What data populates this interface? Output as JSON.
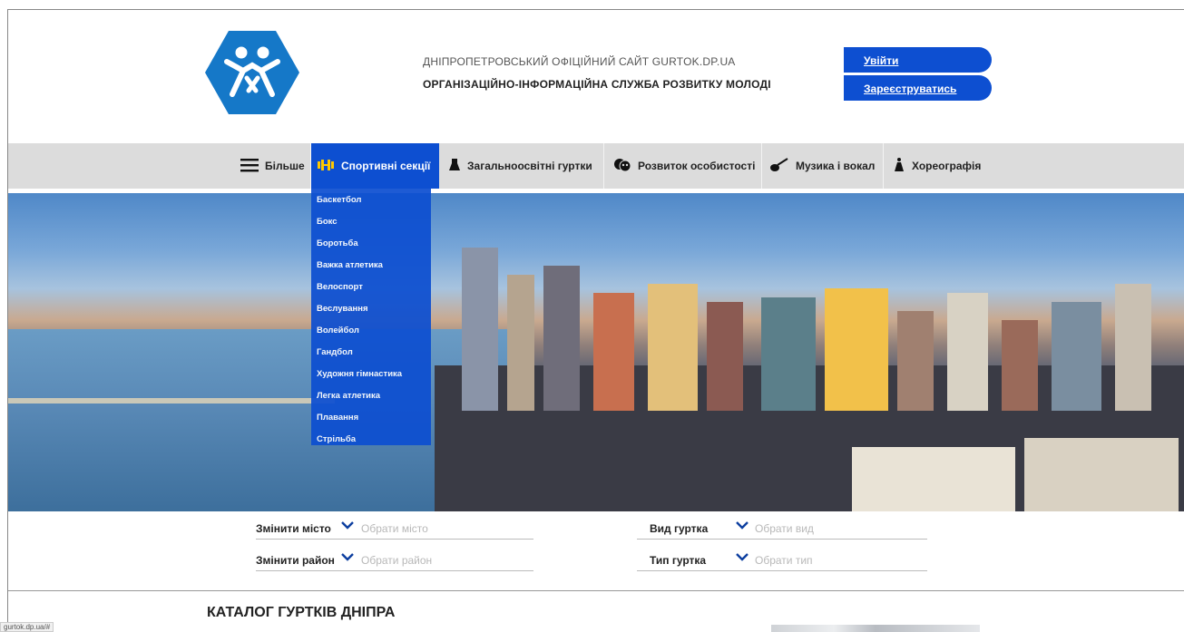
{
  "header": {
    "site_line1": "ДНІПРОПЕТРОВСЬКИЙ ОФІЦІЙНИЙ САЙТ GURTOK.DP.UA",
    "site_line2": "ОРГАНІЗАЦІЙНО-ІНФОРМАЦІЙНА СЛУЖБА РОЗВИТКУ МОЛОДІ",
    "login_label": "Увійти",
    "register_label": "Зареєструватись"
  },
  "nav": {
    "items": [
      {
        "label": "Більше",
        "icon": "hamburger-icon"
      },
      {
        "label": "Спортивні секції",
        "icon": "dumbbell-icon",
        "active": true
      },
      {
        "label": "Загальноосвітні гуртки",
        "icon": "flask-icon"
      },
      {
        "label": "Розвиток особистості",
        "icon": "masks-icon"
      },
      {
        "label": "Музика і вокал",
        "icon": "guitar-icon"
      },
      {
        "label": "Хореографія",
        "icon": "dancer-icon"
      }
    ]
  },
  "dropdown": {
    "items": [
      "Баскетбол",
      "Бокс",
      "Боротьба",
      "Важка атлетика",
      "Велоспорт",
      "Веслування",
      "Волейбол",
      "Гандбол",
      "Художня гімнастика",
      "Легка атлетика",
      "Плавання",
      "Стрільба"
    ]
  },
  "filters": {
    "city_label": "Змінити місто",
    "city_placeholder": "Обрати місто",
    "district_label": "Змінити район",
    "district_placeholder": "Обрати район",
    "kind_label": "Вид гуртка",
    "kind_placeholder": "Обрати вид",
    "type_label": "Тип гуртка",
    "type_placeholder": "Обрати тип"
  },
  "catalog_title": "КАТАЛОГ ГУРТКІВ ДНІПРА",
  "status_url": "gurtok.dp.ua/#",
  "colors": {
    "accent": "#0d4fd1",
    "nav_bg": "#dcdcdc",
    "logo": "#1578c8"
  }
}
